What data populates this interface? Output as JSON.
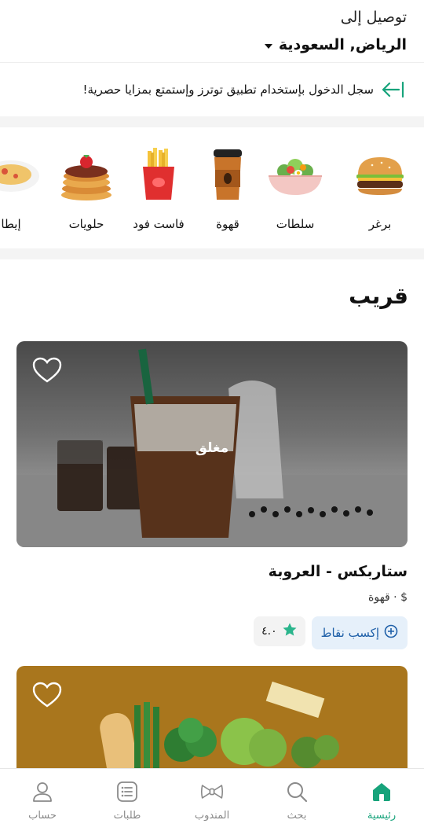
{
  "header": {
    "deliver_to": "توصيل إلى",
    "location": "الرياض, السعودية"
  },
  "login_banner": {
    "text": "سجل الدخول بإستخدام تطبيق توترز وإستمتع بمزايا حصرية!",
    "icon": "login-arrow-icon"
  },
  "categories": [
    {
      "label": "برغر",
      "icon": "burger-icon"
    },
    {
      "label": "سلطات",
      "icon": "salad-icon"
    },
    {
      "label": "قهوة",
      "icon": "coffee-cup-icon"
    },
    {
      "label": "فاست فود",
      "icon": "fries-icon"
    },
    {
      "label": "حلويات",
      "icon": "pancake-icon"
    },
    {
      "label": "إيطا",
      "icon": "pasta-icon"
    }
  ],
  "section": {
    "title": "قريب"
  },
  "stores": [
    {
      "closed_label": "مغلق",
      "name": "ستاربكس - العروبة",
      "price_level": "$",
      "category": "قهوة",
      "separator": "·",
      "rating": "٤.٠",
      "points_label": "إكسب نقاط"
    }
  ],
  "bottom_nav": [
    {
      "label": "رئيسية",
      "icon": "home-icon",
      "active": true
    },
    {
      "label": "بحث",
      "icon": "search-icon",
      "active": false
    },
    {
      "label": "المندوب",
      "icon": "bowtie-icon",
      "active": false
    },
    {
      "label": "طلبات",
      "icon": "orders-list-icon",
      "active": false
    },
    {
      "label": "حساب",
      "icon": "user-icon",
      "active": false
    }
  ],
  "colors": {
    "accent": "#17a37b",
    "points_bg": "#e6f0fa",
    "points_text": "#1e5fa8"
  }
}
